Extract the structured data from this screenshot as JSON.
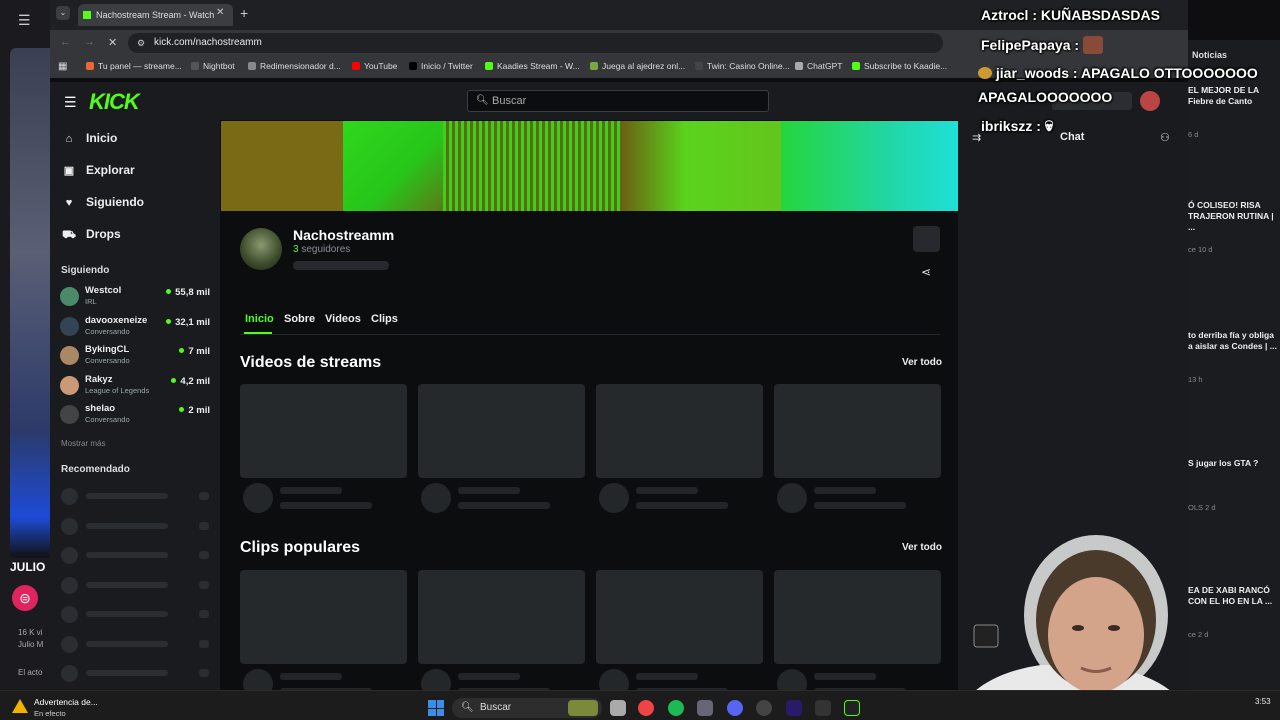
{
  "browser": {
    "tab_title": "Nachostream Stream - Watch",
    "url": "kick.com/nachostreamm",
    "bookmarks": [
      {
        "label": "Tu panel — streame...",
        "color": "#e63"
      },
      {
        "label": "Nightbot",
        "color": "#555"
      },
      {
        "label": "Redimensionador d...",
        "color": "#888"
      },
      {
        "label": "YouTube",
        "color": "#f00"
      },
      {
        "label": "Inicio / Twitter",
        "color": "#000"
      },
      {
        "label": "Kaadies Stream - W...",
        "color": "#53fc18"
      },
      {
        "label": "Juega al ajedrez onl...",
        "color": "#7a4"
      },
      {
        "label": "Twin: Casino Online...",
        "color": "#444"
      },
      {
        "label": "ChatGPT",
        "color": "#aaa"
      },
      {
        "label": "Subscribe to Kaadie...",
        "color": "#53fc18"
      }
    ]
  },
  "left_strip": {
    "name": "JULIO",
    "lines": [
      "16 K vi",
      "Julio M",
      "El acto"
    ]
  },
  "site": {
    "logo": "KICK",
    "search_placeholder": "Buscar",
    "nav": [
      "Inicio",
      "Explorar",
      "Siguiendo",
      "Drops"
    ],
    "nav_icons": [
      "home-icon",
      "compass-icon",
      "heart-icon",
      "gift-icon"
    ],
    "following_title": "Siguiendo",
    "following": [
      {
        "name": "Westcol",
        "sub": "IRL",
        "viewers": "55,8 mil",
        "color": "#4a8a6a"
      },
      {
        "name": "davooxeneize",
        "sub": "Conversando",
        "viewers": "32,1 mil",
        "color": "#345"
      },
      {
        "name": "BykingCL",
        "sub": "Conversando",
        "viewers": "7 mil",
        "color": "#a86"
      },
      {
        "name": "Rakyz",
        "sub": "League of Legends",
        "viewers": "4,2 mil",
        "color": "#c97"
      },
      {
        "name": "shelao",
        "sub": "Conversando",
        "viewers": "2 mil",
        "color": "#444"
      }
    ],
    "show_more": "Mostrar más",
    "recommended_title": "Recomendado"
  },
  "channel": {
    "name": "Nachostreamm",
    "followers_count": "3",
    "followers_label": "seguidores",
    "tabs": [
      "Inicio",
      "Sobre",
      "Videos",
      "Clips"
    ],
    "section1": "Videos de streams",
    "section2": "Clips populares",
    "see_all": "Ver todo",
    "chat_label": "Chat",
    "banner_colors": [
      "#7a6a16",
      "#4cd21e",
      "#32c81b",
      "#6ad81c",
      "#26d6a0"
    ]
  },
  "news": {
    "title": "Noticias",
    "items": [
      {
        "title": "EL MEJOR DE LA Fiebre de Canto",
        "meta": "6 d"
      },
      {
        "title": "Ó COLISEO! RISA TRAJERON RUTINA | ...",
        "meta": "ce 10 d"
      },
      {
        "title": "to derriba fía y obliga a aislar as Condes | ...",
        "meta": "13 h"
      },
      {
        "title": "S jugar los GTA ?",
        "meta": "OLS 2 d"
      },
      {
        "title": "EA DE XABI RANCÓ CON EL HO EN LA ...",
        "meta": "ce 2 d"
      }
    ]
  },
  "overlay_chat": [
    {
      "user": "Aztrocl",
      "msg": ": KUÑABSDASDAS"
    },
    {
      "user": "FelipePapaya",
      "msg": ":"
    },
    {
      "user": "jiar_woods",
      "msg": ": APAGALO OTTOOOOOOO"
    },
    {
      "user": "",
      "msg": "APAGALOOOOOOO"
    },
    {
      "user": "ibrikszz",
      "msg": ":"
    }
  ],
  "taskbar": {
    "warning_title": "Advertencia de...",
    "warning_sub": "En efecto",
    "search": "Buscar",
    "clock": "3:53"
  }
}
